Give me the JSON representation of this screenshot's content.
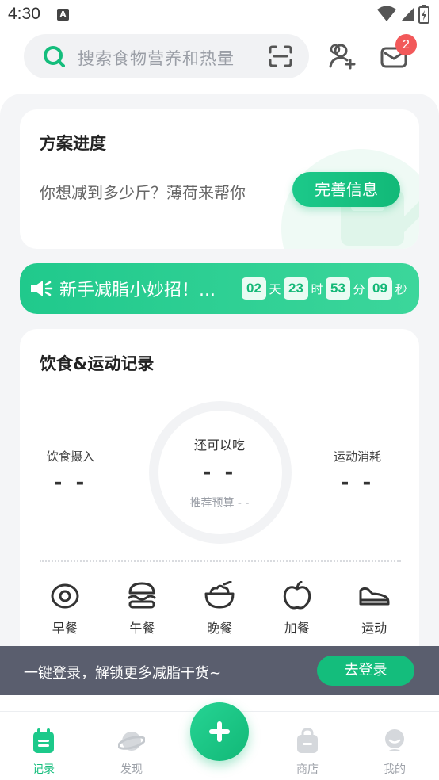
{
  "status_bar": {
    "time": "4:30",
    "notification_icon": "A"
  },
  "header": {
    "search_placeholder": "搜索食物营养和热量",
    "mail_badge_count": "2"
  },
  "plan_card": {
    "title": "方案进度",
    "subtitle": "你想减到多少斤？薄荷来帮你",
    "button_label": "完善信息"
  },
  "promo": {
    "text": "新手减脂小妙招！...",
    "countdown": {
      "days": "02",
      "days_unit": "天",
      "hours": "23",
      "hours_unit": "时",
      "minutes": "53",
      "minutes_unit": "分",
      "seconds": "09",
      "seconds_unit": "秒"
    }
  },
  "record_card": {
    "title": "饮食&运动记录",
    "intake_label": "饮食摄入",
    "intake_value": "- -",
    "remaining_label": "还可以吃",
    "remaining_value": "- -",
    "budget_label": "推荐预算 - -",
    "burn_label": "运动消耗",
    "burn_value": "- -",
    "meals": [
      {
        "label": "早餐",
        "icon": "egg-icon"
      },
      {
        "label": "午餐",
        "icon": "burger-icon"
      },
      {
        "label": "晚餐",
        "icon": "bowl-icon"
      },
      {
        "label": "加餐",
        "icon": "apple-icon"
      },
      {
        "label": "运动",
        "icon": "shoe-icon"
      }
    ]
  },
  "login_bar": {
    "text": "一键登录，解锁更多减脂干货~",
    "button_label": "去登录"
  },
  "bottom_nav": {
    "items": [
      {
        "label": "记录",
        "icon": "clipboard-icon",
        "active": true
      },
      {
        "label": "发现",
        "icon": "planet-icon",
        "active": false
      },
      {
        "label": "商店",
        "icon": "bag-icon",
        "active": false
      },
      {
        "label": "我的",
        "icon": "user-icon",
        "active": false
      }
    ]
  },
  "colors": {
    "brand_green": "#14bd7c",
    "badge_red": "#f2595a",
    "login_bar_bg": "#5a5e6e"
  }
}
